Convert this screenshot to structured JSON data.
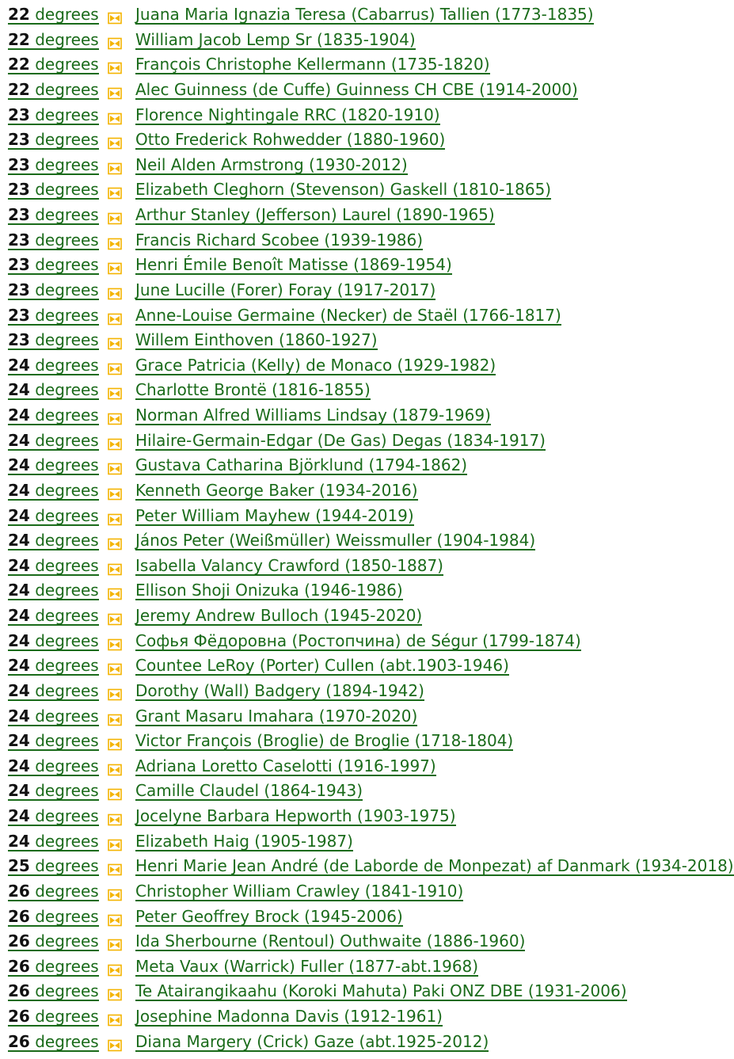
{
  "icon": {
    "name": "envelope-relationship-icon",
    "color": "#f4b400"
  },
  "link_color": "#1a6b1a",
  "rows": [
    {
      "deg": "22",
      "unit": "degrees",
      "name": "Juana Maria Ignazia Teresa (Cabarrus) Tallien (1773-1835)"
    },
    {
      "deg": "22",
      "unit": "degrees",
      "name": "William Jacob Lemp Sr (1835-1904)"
    },
    {
      "deg": "22",
      "unit": "degrees",
      "name": "François Christophe Kellermann (1735-1820)"
    },
    {
      "deg": "22",
      "unit": "degrees",
      "name": "Alec Guinness (de Cuffe) Guinness CH CBE (1914-2000)"
    },
    {
      "deg": "23",
      "unit": "degrees",
      "name": "Florence Nightingale RRC (1820-1910)"
    },
    {
      "deg": "23",
      "unit": "degrees",
      "name": "Otto Frederick Rohwedder (1880-1960)"
    },
    {
      "deg": "23",
      "unit": "degrees",
      "name": "Neil Alden Armstrong (1930-2012)"
    },
    {
      "deg": "23",
      "unit": "degrees",
      "name": "Elizabeth Cleghorn (Stevenson) Gaskell (1810-1865)"
    },
    {
      "deg": "23",
      "unit": "degrees",
      "name": "Arthur Stanley (Jefferson) Laurel (1890-1965)"
    },
    {
      "deg": "23",
      "unit": "degrees",
      "name": "Francis Richard Scobee (1939-1986)"
    },
    {
      "deg": "23",
      "unit": "degrees",
      "name": "Henri Émile Benoît Matisse (1869-1954)"
    },
    {
      "deg": "23",
      "unit": "degrees",
      "name": "June Lucille (Forer) Foray (1917-2017)"
    },
    {
      "deg": "23",
      "unit": "degrees",
      "name": "Anne-Louise Germaine (Necker) de Staël (1766-1817)"
    },
    {
      "deg": "23",
      "unit": "degrees",
      "name": "Willem Einthoven (1860-1927)"
    },
    {
      "deg": "24",
      "unit": "degrees",
      "name": "Grace Patricia (Kelly) de Monaco (1929-1982)"
    },
    {
      "deg": "24",
      "unit": "degrees",
      "name": "Charlotte Brontë (1816-1855)"
    },
    {
      "deg": "24",
      "unit": "degrees",
      "name": "Norman Alfred Williams Lindsay (1879-1969)"
    },
    {
      "deg": "24",
      "unit": "degrees",
      "name": "Hilaire-Germain-Edgar (De Gas) Degas (1834-1917)"
    },
    {
      "deg": "24",
      "unit": "degrees",
      "name": "Gustava Catharina Björklund (1794-1862)"
    },
    {
      "deg": "24",
      "unit": "degrees",
      "name": "Kenneth George Baker (1934-2016)"
    },
    {
      "deg": "24",
      "unit": "degrees",
      "name": "Peter William Mayhew (1944-2019)"
    },
    {
      "deg": "24",
      "unit": "degrees",
      "name": "János Peter (Weißmüller) Weissmuller (1904-1984)"
    },
    {
      "deg": "24",
      "unit": "degrees",
      "name": "Isabella Valancy Crawford (1850-1887)"
    },
    {
      "deg": "24",
      "unit": "degrees",
      "name": "Ellison Shoji Onizuka (1946-1986)"
    },
    {
      "deg": "24",
      "unit": "degrees",
      "name": "Jeremy Andrew Bulloch (1945-2020)"
    },
    {
      "deg": "24",
      "unit": "degrees",
      "name": "Софья Фёдоровна (Ростопчина) de Ségur (1799-1874)"
    },
    {
      "deg": "24",
      "unit": "degrees",
      "name": "Countee LeRoy (Porter) Cullen (abt.1903-1946)"
    },
    {
      "deg": "24",
      "unit": "degrees",
      "name": "Dorothy (Wall) Badgery (1894-1942)"
    },
    {
      "deg": "24",
      "unit": "degrees",
      "name": "Grant Masaru Imahara (1970-2020)"
    },
    {
      "deg": "24",
      "unit": "degrees",
      "name": "Victor François (Broglie) de Broglie (1718-1804)"
    },
    {
      "deg": "24",
      "unit": "degrees",
      "name": "Adriana Loretto Caselotti (1916-1997)"
    },
    {
      "deg": "24",
      "unit": "degrees",
      "name": "Camille Claudel (1864-1943)"
    },
    {
      "deg": "24",
      "unit": "degrees",
      "name": "Jocelyne Barbara Hepworth (1903-1975)"
    },
    {
      "deg": "24",
      "unit": "degrees",
      "name": "Elizabeth Haig (1905-1987)"
    },
    {
      "deg": "25",
      "unit": "degrees",
      "name": "Henri Marie Jean André (de Laborde de Monpezat) af Danmark (1934-2018)"
    },
    {
      "deg": "26",
      "unit": "degrees",
      "name": "Christopher William Crawley (1841-1910)"
    },
    {
      "deg": "26",
      "unit": "degrees",
      "name": "Peter Geoffrey Brock (1945-2006)"
    },
    {
      "deg": "26",
      "unit": "degrees",
      "name": "Ida Sherbourne (Rentoul) Outhwaite (1886-1960)"
    },
    {
      "deg": "26",
      "unit": "degrees",
      "name": "Meta Vaux (Warrick) Fuller (1877-abt.1968)"
    },
    {
      "deg": "26",
      "unit": "degrees",
      "name": "Te Atairangikaahu (Koroki Mahuta) Paki ONZ DBE (1931-2006)"
    },
    {
      "deg": "26",
      "unit": "degrees",
      "name": "Josephine Madonna Davis (1912-1961)"
    },
    {
      "deg": "26",
      "unit": "degrees",
      "name": "Diana Margery (Crick) Gaze (abt.1925-2012)"
    }
  ]
}
